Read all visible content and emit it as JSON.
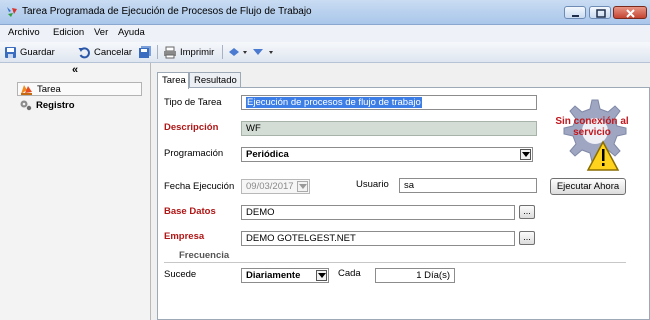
{
  "window": {
    "title": "Tarea Programada de Ejecución de Procesos de Flujo de Trabajo"
  },
  "menu": [
    "Archivo",
    "Edicion",
    "Ver",
    "Ayuda"
  ],
  "toolbar": {
    "save_label": "Guardar",
    "cancel_label": "Cancelar",
    "print_label": "Imprimir"
  },
  "sidebar": {
    "collapse_glyph": "«",
    "items": [
      {
        "label": "Tarea",
        "selected": true
      },
      {
        "label": "Registro",
        "selected": false
      }
    ]
  },
  "tabs": [
    {
      "label": "Tarea",
      "active": true
    },
    {
      "label": "Resultado",
      "active": false
    }
  ],
  "form": {
    "tipo_label": "Tipo de Tarea",
    "tipo_value": "Ejecución de procesos de flujo de trabajo",
    "descripcion_label": "Descripción",
    "descripcion_value": "WF",
    "programacion_label": "Programación",
    "programacion_value": "Periódica",
    "fecha_label": "Fecha Ejecución",
    "fecha_value": "09/03/2017",
    "usuario_label": "Usuario",
    "usuario_value": "sa",
    "basedatos_label": "Base Datos",
    "basedatos_value": "DEMO",
    "empresa_label": "Empresa",
    "empresa_value": "DEMO GOTELGEST.NET",
    "frecuencia_label": "Frecuencia",
    "sucede_label": "Sucede",
    "sucede_value": "Diariamente",
    "cada_label": "Cada",
    "cada_value": "1 Día(s)",
    "ellipsis": "..."
  },
  "status": {
    "offline_text": "Sin conexión al servicio",
    "execute_button": "Ejecutar Ahora"
  },
  "colors": {
    "required_label": "#b01616",
    "selection": "#3d7ee6",
    "readonly_field": "#d3ddd5",
    "offline_text": "#c1171d"
  }
}
